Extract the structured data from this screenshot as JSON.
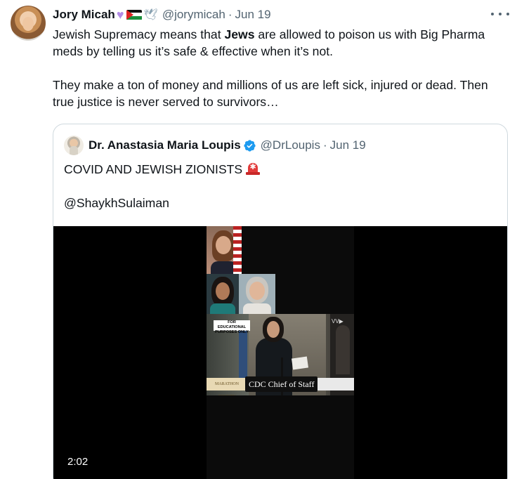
{
  "tweet": {
    "author_name": "Jory Micah",
    "author_emojis": [
      "purple-heart",
      "palestine-flag",
      "dove"
    ],
    "handle": "@jorymicah",
    "date": "Jun 19",
    "text_line1": "Jewish Supremacy means that ",
    "text_bold": "Jews",
    "text_line1_rest": " are allowed to poison us with Big Pharma meds by telling us it’s safe & effective when it’s not.",
    "text_para2": "They make a ton of money and millions of us are left sick, injured or dead. Then true justice is never served to survivors…",
    "more_icon": "more-horizontal-icon"
  },
  "quote": {
    "author_name": "Dr. Anastasia Maria Loupis",
    "verified": true,
    "handle": "@DrLoupis",
    "date": "Jun 19",
    "text": "COVID AND JEWISH ZIONISTS",
    "emoji": "police-light",
    "mention": "@ShaykhSulaiman"
  },
  "video": {
    "overlay_label": "FOR EDUCATIONAL PURPOSES ONLY",
    "brand": "MARATHON COUNTY",
    "caption": "CDC Chief of Staff",
    "duration": "2:02"
  },
  "colors": {
    "text": "#0f1419",
    "secondary": "#536471",
    "border": "#cfd9de",
    "verified": "#1d9bf0"
  }
}
